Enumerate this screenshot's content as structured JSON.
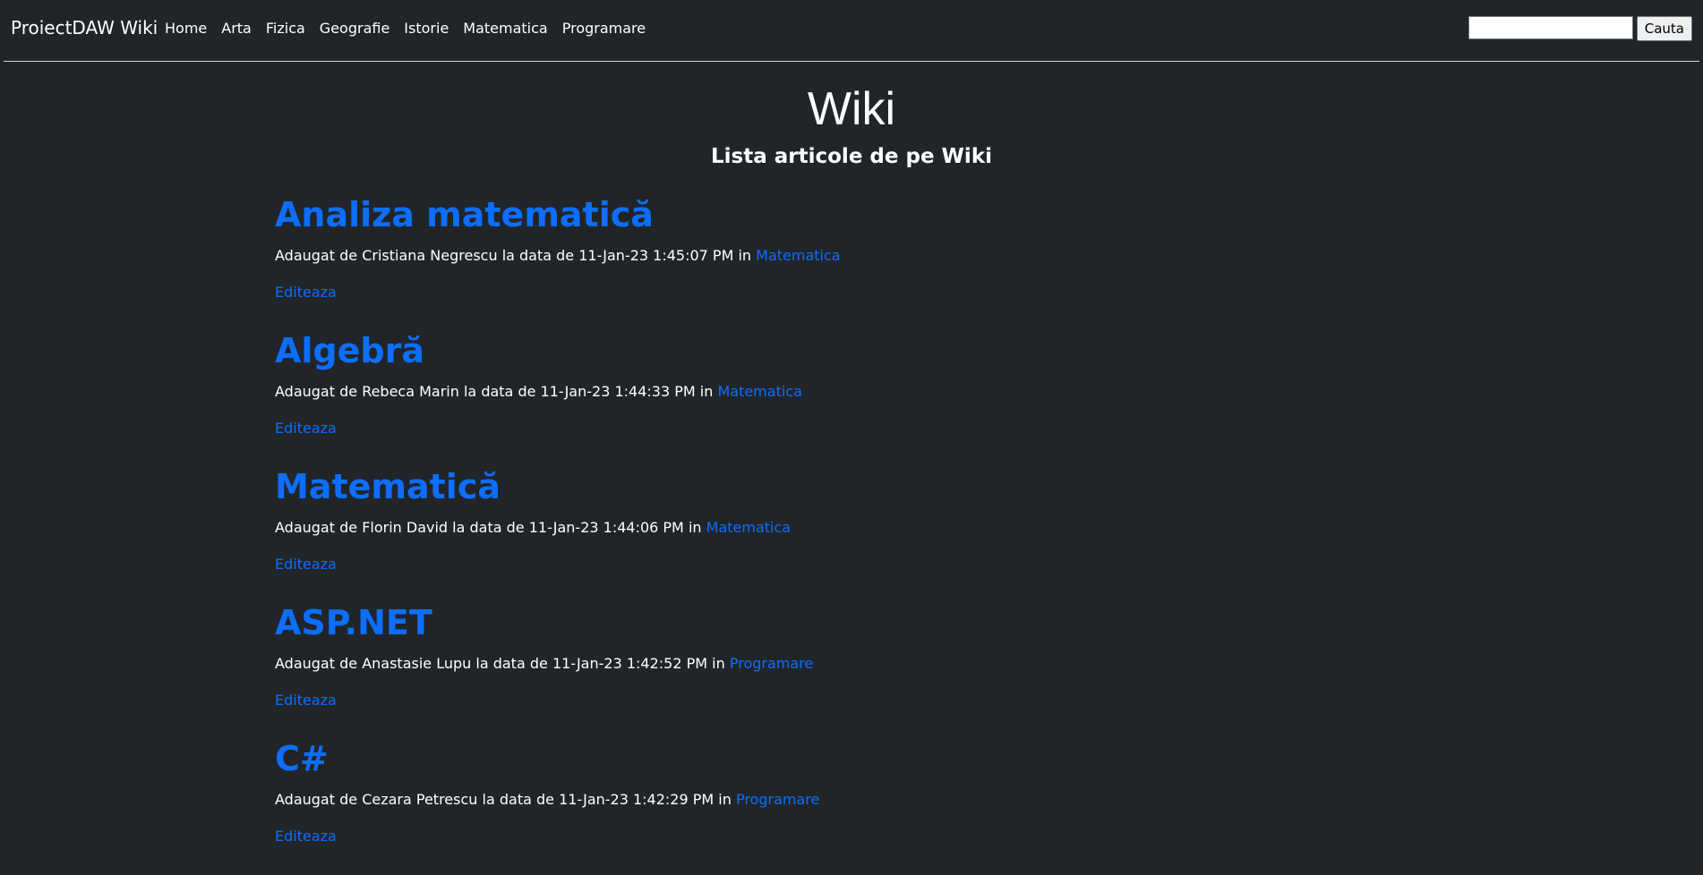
{
  "navbar": {
    "brand": "ProiectDAW Wiki",
    "links": [
      "Home",
      "Arta",
      "Fizica",
      "Geografie",
      "Istorie",
      "Matematica",
      "Programare"
    ],
    "search_placeholder": "",
    "search_value": "",
    "search_button": "Cauta"
  },
  "header": {
    "title": "Wiki",
    "subtitle": "Lista articole de pe Wiki"
  },
  "articles": [
    {
      "title": "Analiza matematică",
      "added_by_prefix": "Adaugat de",
      "author": "Cristiana Negrescu",
      "date_prefix": "la data de",
      "date": "11-Jan-23 1:45:07 PM",
      "in_label": "in",
      "category": "Matematica",
      "edit_label": "Editeaza"
    },
    {
      "title": "Algebră",
      "added_by_prefix": "Adaugat de",
      "author": "Rebeca Marin",
      "date_prefix": "la data de",
      "date": "11-Jan-23 1:44:33 PM",
      "in_label": "in",
      "category": "Matematica",
      "edit_label": "Editeaza"
    },
    {
      "title": "Matematică",
      "added_by_prefix": "Adaugat de",
      "author": "Florin David",
      "date_prefix": "la data de",
      "date": "11-Jan-23 1:44:06 PM",
      "in_label": "in",
      "category": "Matematica",
      "edit_label": "Editeaza"
    },
    {
      "title": "ASP.NET",
      "added_by_prefix": "Adaugat de",
      "author": "Anastasie Lupu",
      "date_prefix": "la data de",
      "date": "11-Jan-23 1:42:52 PM",
      "in_label": "in",
      "category": "Programare",
      "edit_label": "Editeaza"
    },
    {
      "title": "C#",
      "added_by_prefix": "Adaugat de",
      "author": "Cezara Petrescu",
      "date_prefix": "la data de",
      "date": "11-Jan-23 1:42:29 PM",
      "in_label": "in",
      "category": "Programare",
      "edit_label": "Editeaza"
    }
  ],
  "colors": {
    "background": "#212529",
    "link": "#0d6efd",
    "text": "#ffffff"
  }
}
